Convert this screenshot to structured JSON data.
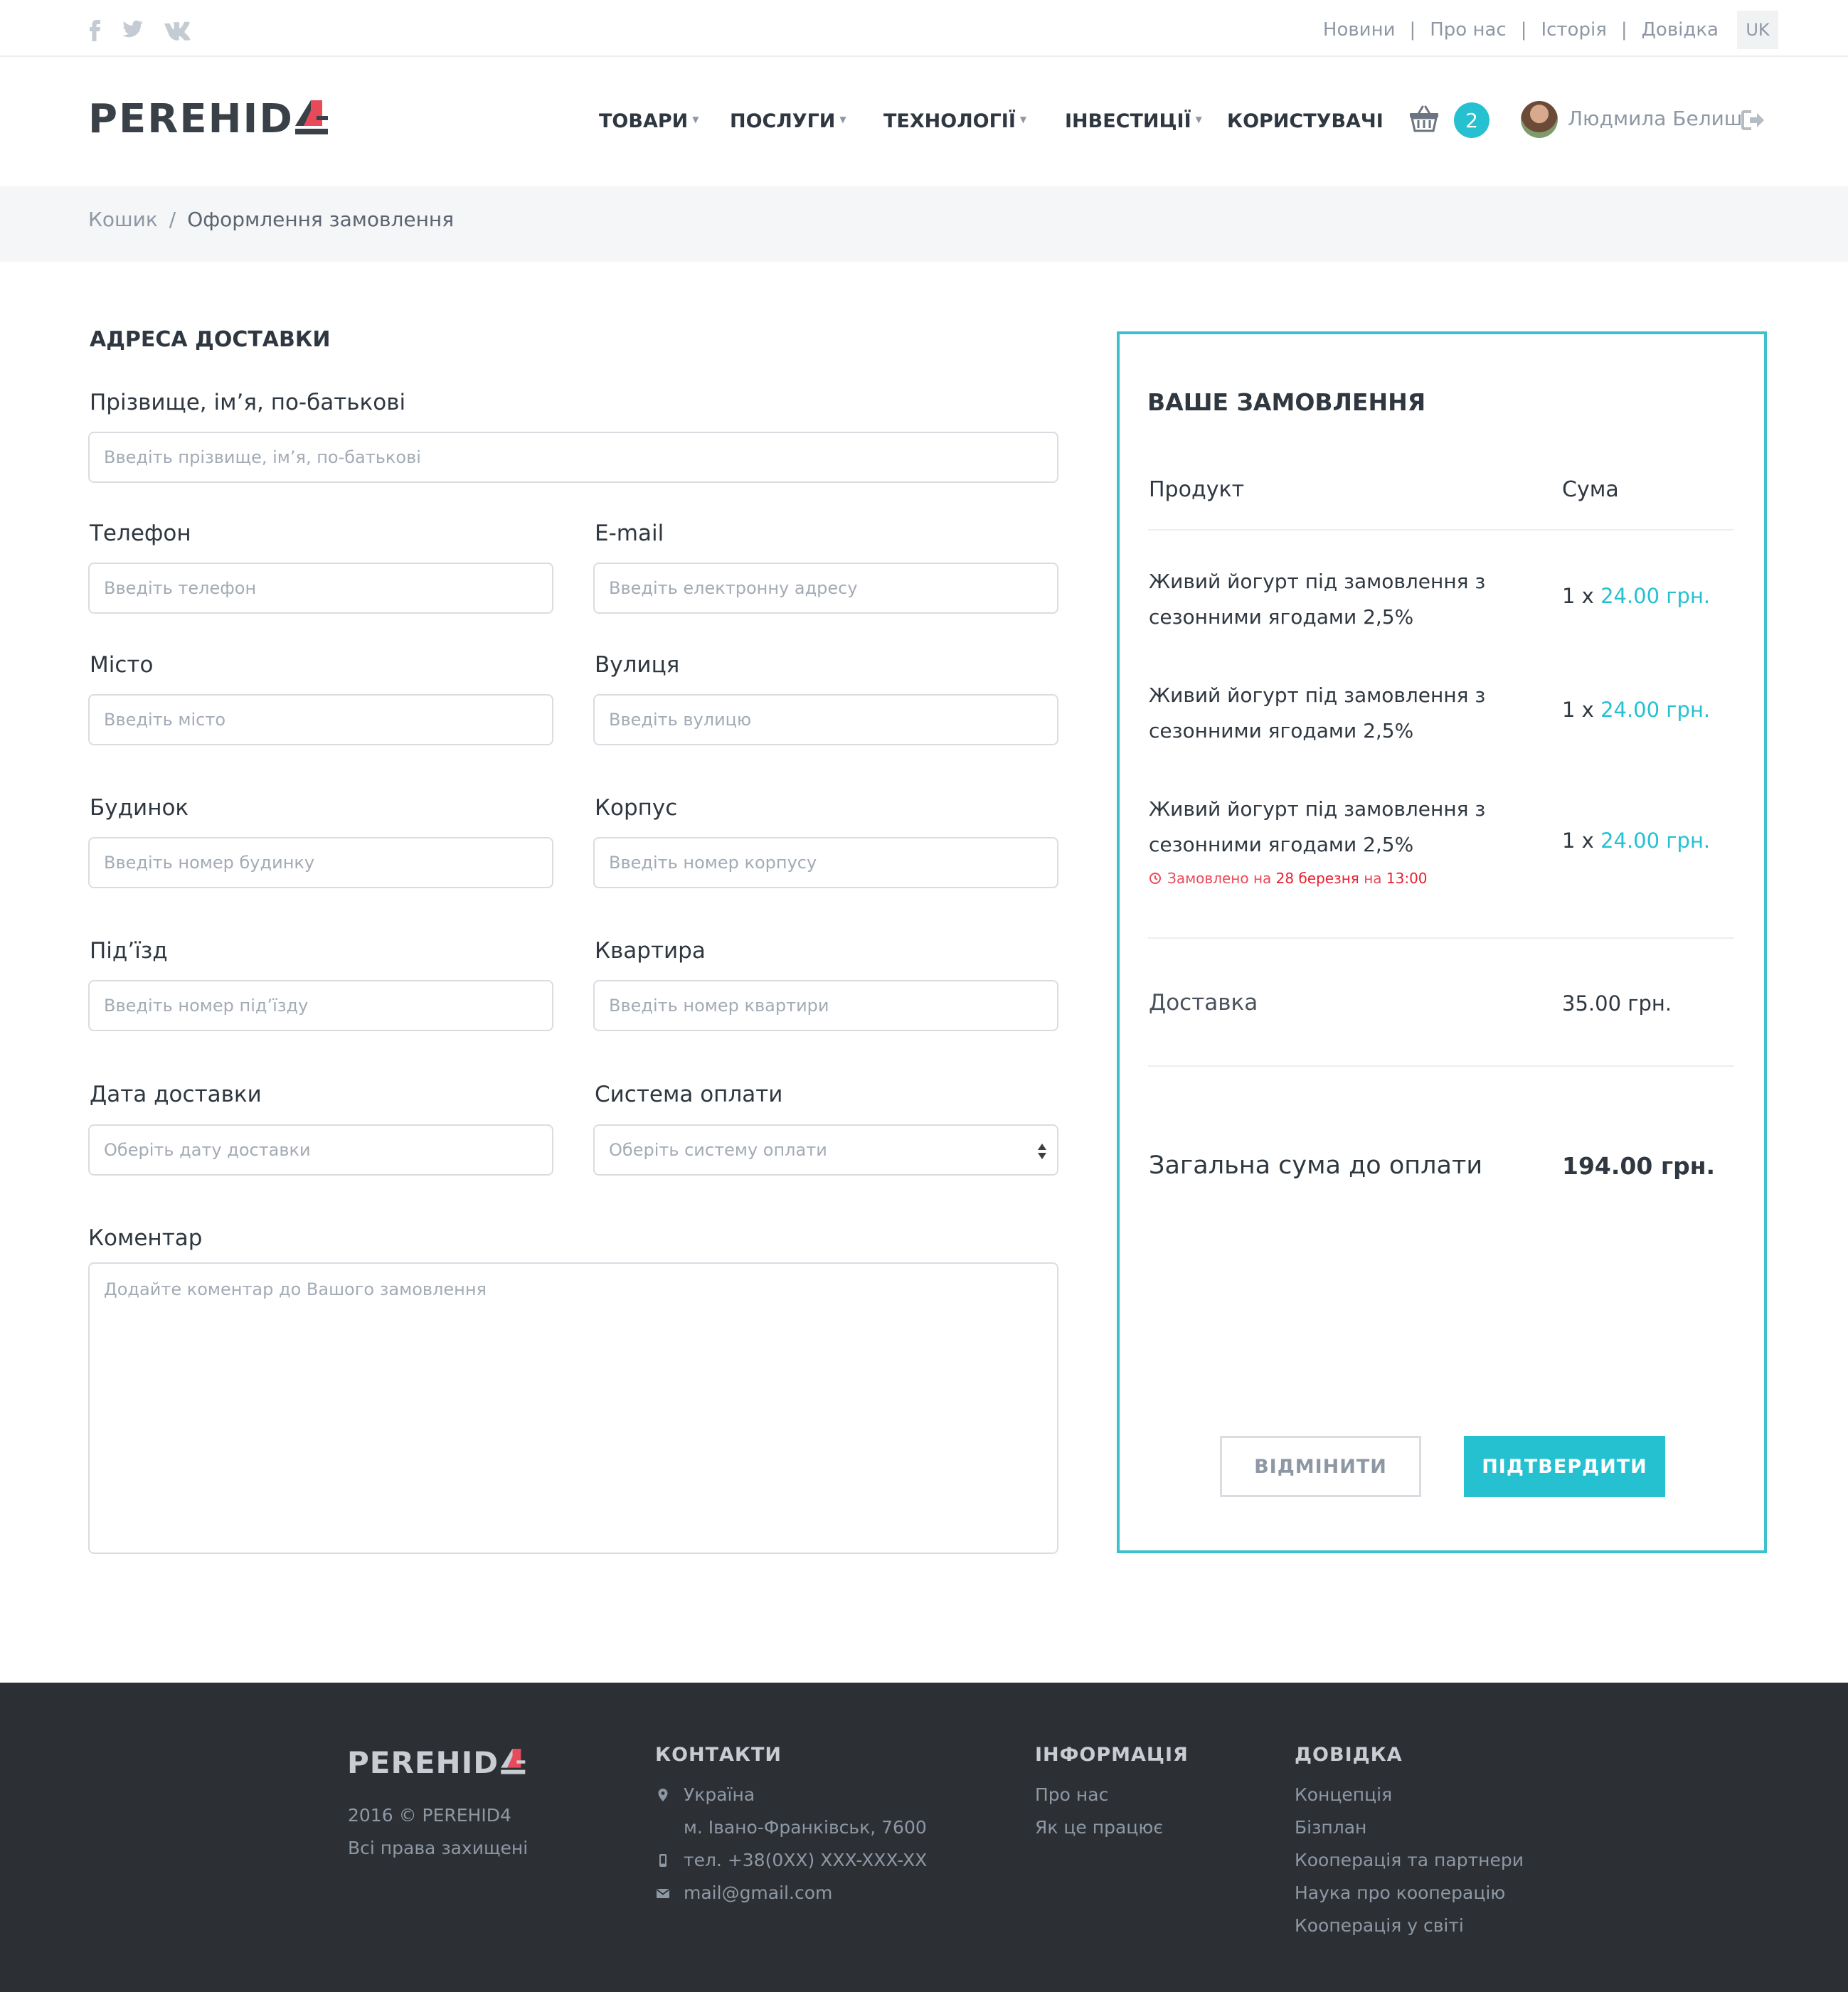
{
  "topbar": {
    "social": [
      "facebook-icon",
      "twitter-icon",
      "vk-icon"
    ],
    "links": [
      "Новини",
      "Про нас",
      "Історія",
      "Довідка"
    ],
    "lang": "UK"
  },
  "header": {
    "logo": "PEREHID",
    "nav": [
      "ТОВАРИ",
      "ПОСЛУГИ",
      "ТЕХНОЛОГІЇ",
      "ІНВЕСТИЦІЇ",
      "КОРИСТУВАЧІ"
    ],
    "cart_count": "2",
    "user_name": "Людмила Белиш"
  },
  "breadcrumb": {
    "items": [
      "Кошик",
      "Оформлення замовлення"
    ],
    "separator": "/"
  },
  "form": {
    "title": "АДРЕСА ДОСТАВКИ",
    "fields": {
      "fullname": {
        "label": "Прізвище, ім’я, по-батькові",
        "placeholder": "Введіть прізвище, ім’я, по-батькові"
      },
      "phone": {
        "label": "Телефон",
        "placeholder": "Введіть телефон"
      },
      "email": {
        "label": "E-mail",
        "placeholder": "Введіть електронну адресу"
      },
      "city": {
        "label": "Місто",
        "placeholder": "Введіть місто"
      },
      "street": {
        "label": "Вулиця",
        "placeholder": "Введіть вулицю"
      },
      "house": {
        "label": "Будинок",
        "placeholder": "Введіть номер будинку"
      },
      "building": {
        "label": "Корпус",
        "placeholder": "Введіть номер корпусу"
      },
      "entrance": {
        "label": "Під’їзд",
        "placeholder": "Введіть номер під’їзду"
      },
      "apartment": {
        "label": "Квартира",
        "placeholder": "Введіть номер квартири"
      },
      "date": {
        "label": "Дата доставки",
        "placeholder": "Оберіть дату доставки"
      },
      "payment": {
        "label": "Система оплати",
        "placeholder": "Оберіть систему оплати"
      },
      "comment": {
        "label": "Коментар",
        "placeholder": "Додайте коментар до Вашого замовлення"
      }
    }
  },
  "order": {
    "title": "ВАШЕ ЗАМОВЛЕННЯ",
    "col_product": "Продукт",
    "col_sum": "Сума",
    "items": [
      {
        "name": "Живий йогурт під замовлення з сезонними ягодами 2,5%",
        "qty": "1 x",
        "price": "24.00 грн."
      },
      {
        "name": "Живий йогурт під замовлення з сезонними ягодами 2,5%",
        "qty": "1 x",
        "price": "24.00 грн."
      },
      {
        "name": "Живий йогурт під замовлення з сезонними ягодами 2,5%",
        "qty": "1 x",
        "price": "24.00 грн.",
        "note_prefix": "Замовлено на",
        "note_date": "28 березня",
        "note_mid": "на",
        "note_time": "13:00"
      }
    ],
    "delivery_label": "Доставка",
    "delivery_value": "35.00 грн.",
    "total_label": "Загальна сума до оплати",
    "total_value": "194.00 грн.",
    "cancel_label": "ВІДМІНИТИ",
    "confirm_label": "ПІДТВЕРДИТИ"
  },
  "footer": {
    "logo": "PEREHID",
    "copyright": "2016 © PEREHID4",
    "rights": "Всі права захищені",
    "contacts": {
      "title": "КОНТАКТИ",
      "country": "Україна",
      "city": "м. Івано-Франківськ, 7600",
      "phone": "тел. +38(0XX) XXX-XXX-XX",
      "email": "mail@gmail.com"
    },
    "info": {
      "title": "ІНФОРМАЦІЯ",
      "links": [
        "Про нас",
        "Як це працює"
      ]
    },
    "help": {
      "title": "ДОВІДКА",
      "links": [
        "Концепція",
        "Бізплан",
        "Кооперація та партнери",
        "Наука про кооперацію",
        "Кооперація у світі"
      ]
    }
  },
  "colors": {
    "accent": "#25c1d1",
    "panel_border": "#3bc0cc",
    "alert": "#e8202f",
    "footer_bg": "#2c3035"
  }
}
